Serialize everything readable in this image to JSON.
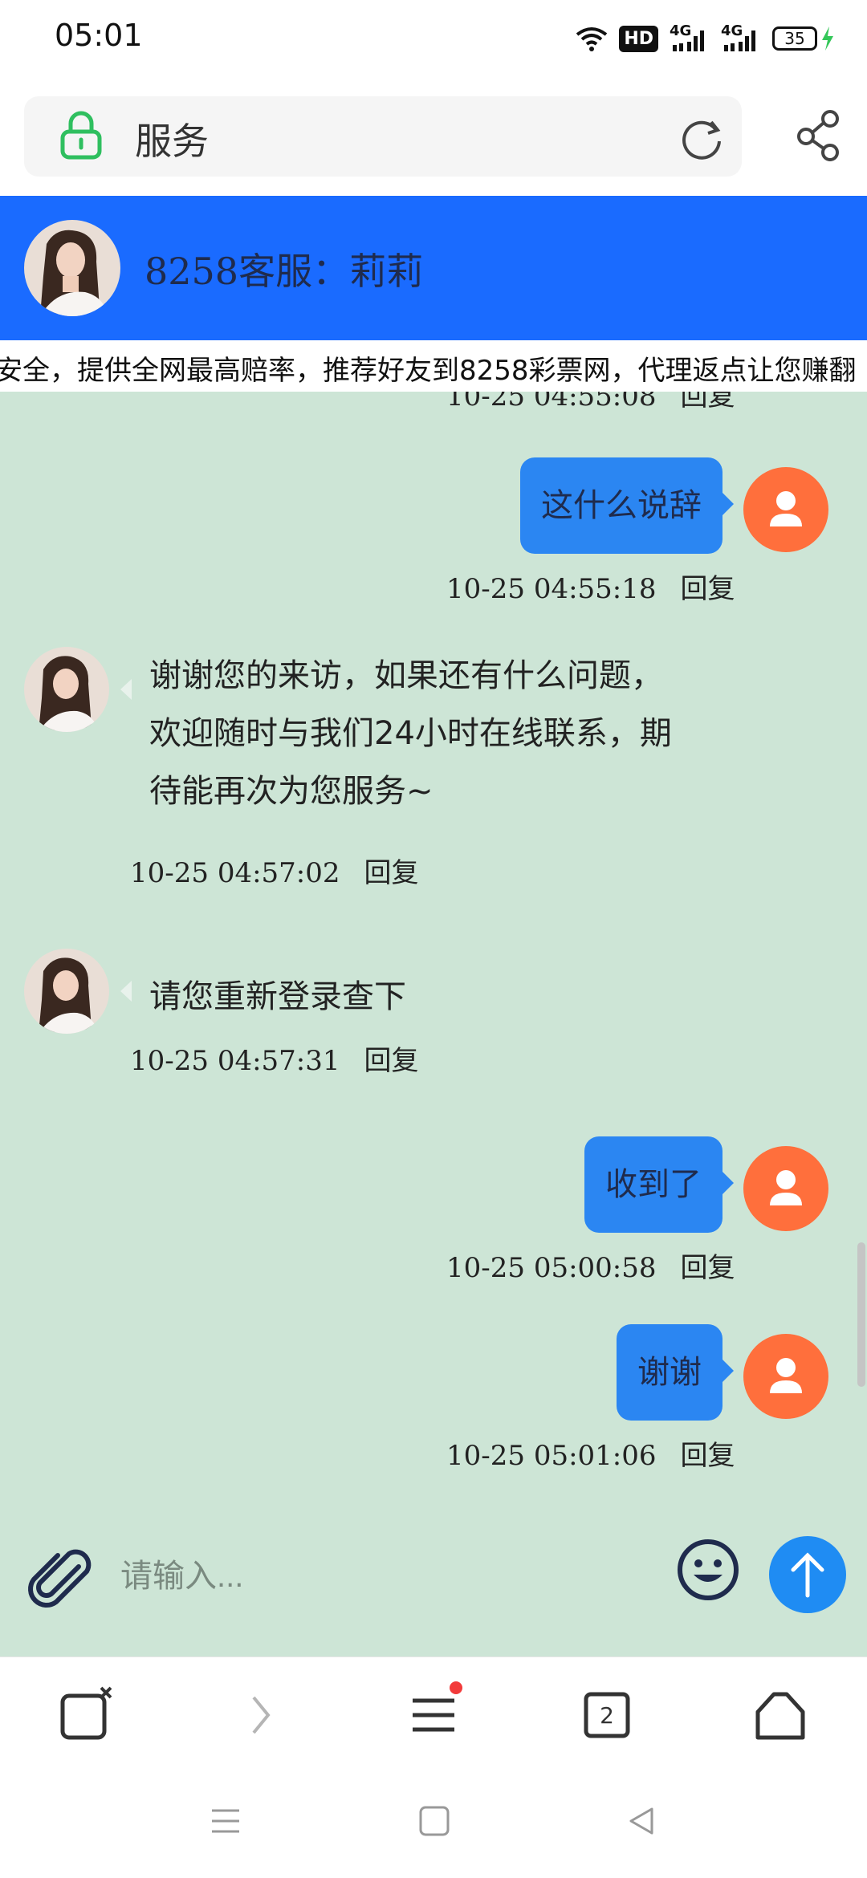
{
  "status_bar": {
    "time": "05:01",
    "hd_label": "HD",
    "network1": "4G",
    "network2": "4G",
    "battery": "35"
  },
  "address_bar": {
    "title": "服务"
  },
  "chat_header": {
    "agent_name": "8258客服：莉莉"
  },
  "marquee": {
    "text": "安全，提供全网最高赔率，推荐好友到8258彩票网，代理返点让您赚翻"
  },
  "messages": [
    {
      "direction": "out",
      "text": "这什么说辞",
      "timestamp": "10-25 04:55:18",
      "reply": "回复"
    },
    {
      "direction": "in",
      "lines": [
        "谢谢您的来访，如果还有什么问题，",
        "欢迎随时与我们24小时在线联系，期",
        "待能再次为您服务~"
      ],
      "timestamp": "10-25 04:57:02",
      "reply": "回复"
    },
    {
      "direction": "in",
      "lines": [
        "请您重新登录查下"
      ],
      "timestamp": "10-25 04:57:31",
      "reply": "回复"
    },
    {
      "direction": "out",
      "text": "收到了",
      "timestamp": "10-25 05:00:58",
      "reply": "回复"
    },
    {
      "direction": "out",
      "text": "谢谢",
      "timestamp": "10-25 05:01:06",
      "reply": "回复"
    }
  ],
  "partial_top": {
    "timestamp": "10-25 04:55:08",
    "reply": "回复"
  },
  "input": {
    "placeholder": "请输入..."
  },
  "browser_nav": {
    "tab_count": "2"
  },
  "colors": {
    "header_blue": "#1a6bff",
    "chat_bg": "#cde5d6",
    "bubble_blue": "#2b86f2",
    "user_avatar": "#ff6f3c",
    "send_blue": "#1f8cf3"
  }
}
